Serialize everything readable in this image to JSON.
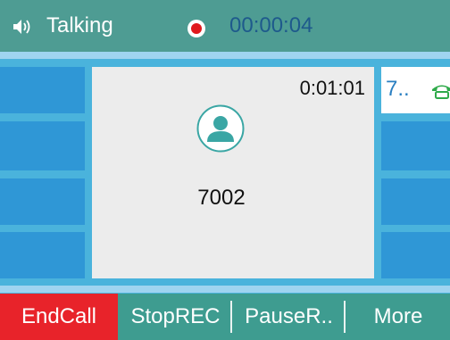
{
  "status_bar": {
    "status_text": "Talking",
    "recording_timer": "00:00:04",
    "icons": [
      "speaker-icon",
      "recording-icon"
    ]
  },
  "line_key": {
    "label": "7..",
    "icon": "phone-icon"
  },
  "call": {
    "duration": "0:01:01",
    "contact_number": "7002",
    "avatar_icon": "contact-avatar-icon"
  },
  "softkeys": [
    {
      "label": "EndCall"
    },
    {
      "label": "StopREC"
    },
    {
      "label": "PauseR.."
    },
    {
      "label": "More"
    }
  ],
  "colors": {
    "header": "#4e9c93",
    "softkey_bar": "#3e9c90",
    "end_call": "#e8232a",
    "tile": "#2f97d6",
    "background": "#4ab3dc",
    "recording_dot": "#e0191d"
  }
}
